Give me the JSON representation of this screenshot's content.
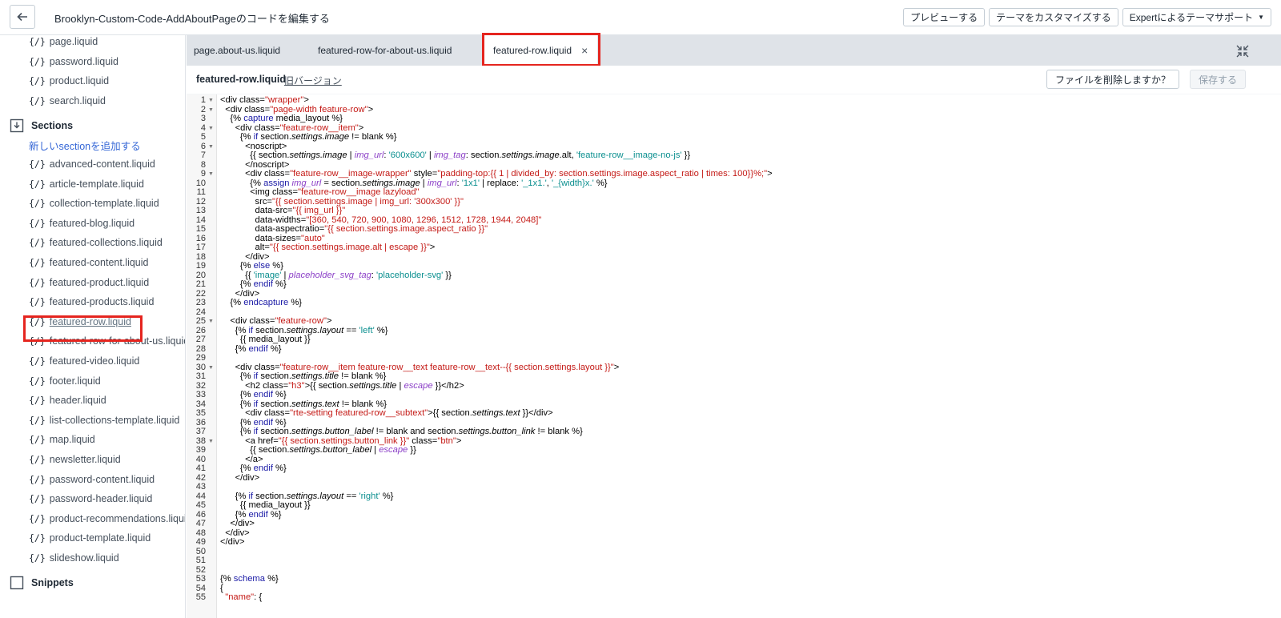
{
  "header": {
    "title": "Brooklyn-Custom-Code-AddAboutPageのコードを編集する",
    "preview_label": "プレビューする",
    "customize_label": "テーマをカスタマイズする",
    "support_label": "Expertによるテーマサポート"
  },
  "sidebar": {
    "top_files": [
      "page.liquid",
      "password.liquid",
      "product.liquid",
      "search.liquid"
    ],
    "sections_label": "Sections",
    "add_section_label": "新しいsectionを追加する",
    "section_files": [
      "advanced-content.liquid",
      "article-template.liquid",
      "collection-template.liquid",
      "featured-blog.liquid",
      "featured-collections.liquid",
      "featured-content.liquid",
      "featured-product.liquid",
      "featured-products.liquid",
      "featured-row.liquid",
      "featured-row-for-about-us.liquid",
      "featured-video.liquid",
      "footer.liquid",
      "header.liquid",
      "list-collections-template.liquid",
      "map.liquid",
      "newsletter.liquid",
      "password-content.liquid",
      "password-header.liquid",
      "product-recommendations.liquid",
      "product-template.liquid",
      "slideshow.liquid"
    ],
    "snippets_label": "Snippets",
    "file_icon": "{/}"
  },
  "tabs": [
    {
      "label": "page.about-us.liquid"
    },
    {
      "label": "featured-row-for-about-us.liquid"
    },
    {
      "label": "featured-row.liquid",
      "close": "×"
    }
  ],
  "filebar": {
    "filename": "featured-row.liquid",
    "old_version": "旧バージョン",
    "delete_label": "ファイルを削除しますか？",
    "save_label": "保存する"
  },
  "colors": {
    "highlight": "#e5251f",
    "link": "#3466d6",
    "string": "#c41a16",
    "keyword": "#1a1aa6",
    "filter": "#8b3fc7"
  },
  "code_lines": [
    "<div class=\"wrapper\">",
    "  <div class=\"page-width feature-row\">",
    "    {% capture media_layout %}",
    "      <div class=\"feature-row__item\">",
    "        {% if section.settings.image != blank %}",
    "          <noscript>",
    "            {{ section.settings.image | img_url: '600x600' | img_tag: section.settings.image.alt, 'feature-row__image-no-js' }}",
    "          </noscript>",
    "          <div class=\"feature-row__image-wrapper\" style=\"padding-top:{{ 1 | divided_by: section.settings.image.aspect_ratio | times: 100}}%;\">",
    "            {% assign img_url = section.settings.image | img_url: '1x1' | replace: '_1x1.', '_{width}x.' %}",
    "            <img class=\"feature-row__image lazyload\"",
    "              src=\"{{ section.settings.image | img_url: '300x300' }}\"",
    "              data-src=\"{{ img_url }}\"",
    "              data-widths=\"[360, 540, 720, 900, 1080, 1296, 1512, 1728, 1944, 2048]\"",
    "              data-aspectratio=\"{{ section.settings.image.aspect_ratio }}\"",
    "              data-sizes=\"auto\"",
    "              alt=\"{{ section.settings.image.alt | escape }}\">",
    "          </div>",
    "        {% else %}",
    "          {{ 'image' | placeholder_svg_tag: 'placeholder-svg' }}",
    "        {% endif %}",
    "      </div>",
    "    {% endcapture %}",
    "",
    "    <div class=\"feature-row\">",
    "      {% if section.settings.layout == 'left' %}",
    "        {{ media_layout }}",
    "      {% endif %}",
    "",
    "      <div class=\"feature-row__item feature-row__text feature-row__text--{{ section.settings.layout }}\">",
    "        {% if section.settings.title != blank %}",
    "          <h2 class=\"h3\">{{ section.settings.title | escape }}</h2>",
    "        {% endif %}",
    "        {% if section.settings.text != blank %}",
    "          <div class=\"rte-setting featured-row__subtext\">{{ section.settings.text }}</div>",
    "        {% endif %}",
    "        {% if section.settings.button_label != blank and section.settings.button_link != blank %}",
    "          <a href=\"{{ section.settings.button_link }}\" class=\"btn\">",
    "            {{ section.settings.button_label | escape }}",
    "          </a>",
    "        {% endif %}",
    "      </div>",
    "",
    "      {% if section.settings.layout == 'right' %}",
    "        {{ media_layout }}",
    "      {% endif %}",
    "    </div>",
    "  </div>",
    "</div>",
    "",
    "",
    "",
    "{% schema %}",
    "{",
    "  \"name\": {"
  ]
}
